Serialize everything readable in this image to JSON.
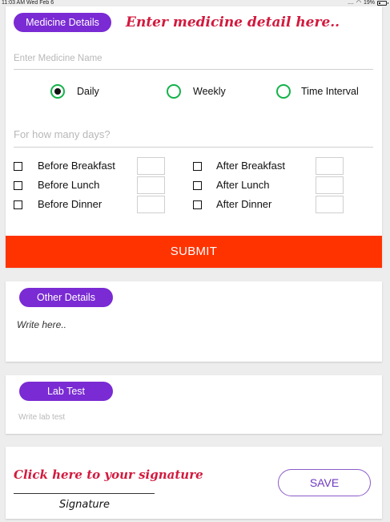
{
  "status_bar": {
    "time": "11:03 AM  Wed Feb 6",
    "signal": "....",
    "battery": "19%"
  },
  "medicine": {
    "header_pill": "Medicine Details",
    "header_hint": "Enter medicine detail here..",
    "name_placeholder": "Enter Medicine Name",
    "frequency_options": [
      {
        "label": "Daily",
        "checked": true
      },
      {
        "label": "Weekly",
        "checked": false
      },
      {
        "label": "Time Interval",
        "checked": false
      }
    ],
    "days_placeholder": "For how many days?",
    "meal_times": [
      {
        "left": "Before Breakfast",
        "right": "After Breakfast"
      },
      {
        "left": "Before Lunch",
        "right": "After Lunch"
      },
      {
        "left": "Before Dinner",
        "right": "After Dinner"
      }
    ],
    "submit_label": "SUBMIT"
  },
  "other_details": {
    "pill": "Other Details",
    "placeholder": "Write here.."
  },
  "lab_test": {
    "pill": "Lab Test",
    "placeholder": "Write lab test"
  },
  "signature": {
    "prompt": "Click here to your signature",
    "label": "Signature",
    "save_label": "SAVE"
  },
  "colors": {
    "pill": "#7a2bd3",
    "submit": "#ff3300",
    "radio": "#14b24a",
    "script": "#d21a3e"
  }
}
